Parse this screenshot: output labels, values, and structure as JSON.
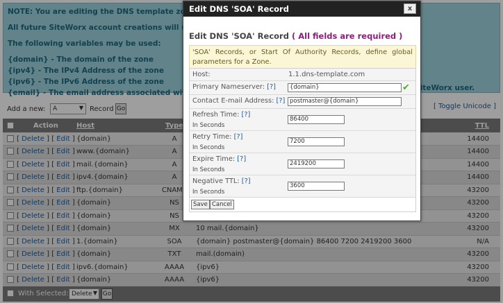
{
  "notice": {
    "lines": [
      "NOTE: You are editing the DNS template zone.",
      "All future SiteWorx account creations will use a",
      "The following variables may be used:",
      "{domain} - The domain of the zone",
      "{ipv4} - The IPv4 Address of the zone",
      "{ipv6} - The IPv6 Address of the zone",
      "{email} - The email address associated with"
    ],
    "tail": "SiteWorx user."
  },
  "addbar": {
    "label": "Add a new:",
    "select_value": "A",
    "record_label": "Record",
    "go_label": "Go",
    "toggle_label": "[ Toggle Unicode ]"
  },
  "table": {
    "headers": {
      "action": "Action",
      "host": "Host",
      "type": "Type",
      "ttl": "TTL"
    },
    "delete_label": "Delete",
    "edit_label": "Edit",
    "rows": [
      {
        "host": "{domain}",
        "type": "A",
        "data": "",
        "ttl": "14400"
      },
      {
        "host": "www.{domain}",
        "type": "A",
        "data": "",
        "ttl": "14400"
      },
      {
        "host": "mail.{domain}",
        "type": "A",
        "data": "",
        "ttl": "14400"
      },
      {
        "host": "ipv4.{domain}",
        "type": "A",
        "data": "",
        "ttl": "14400"
      },
      {
        "host": "ftp.{domain}",
        "type": "CNAME",
        "data": "",
        "ttl": "43200"
      },
      {
        "host": "{domain}",
        "type": "NS",
        "data": "",
        "ttl": "43200"
      },
      {
        "host": "{domain}",
        "type": "NS",
        "data": "",
        "ttl": "43200"
      },
      {
        "host": "{domain}",
        "type": "MX",
        "data": "10 mail.{domain}",
        "ttl": "43200"
      },
      {
        "host": "1.{domain}",
        "type": "SOA",
        "data": "{domain} postmaster@{domain} 86400 7200 2419200 3600",
        "ttl": "N/A"
      },
      {
        "host": "{domain}",
        "type": "TXT",
        "data": "mail.(domain)",
        "ttl": "43200"
      },
      {
        "host": "ipv6.{domain}",
        "type": "AAAA",
        "data": "{ipv6}",
        "ttl": "43200"
      },
      {
        "host": "{domain}",
        "type": "AAAA",
        "data": "{ipv6}",
        "ttl": "43200"
      }
    ]
  },
  "footer": {
    "with_selected": "With Selected:",
    "select_value": "Delete",
    "go_label": "Go"
  },
  "modal": {
    "title": "Edit DNS 'SOA' Record",
    "close_label": "x",
    "heading": "Edit DNS 'SOA' Record",
    "required": "( All fields are required )",
    "description": "'SOA' Records, or Start Of Authority Records, define global parameters for a Zone.",
    "host_label": "Host:",
    "host_value": "1.1.dns-template.com",
    "primary_ns_label": "Primary Nameserver:",
    "primary_ns_value": "{domain}",
    "contact_label": "Contact E-mail Address:",
    "contact_value": "postmaster@{domain}",
    "refresh_label": "Refresh Time:",
    "refresh_value": "86400",
    "retry_label": "Retry Time:",
    "retry_value": "7200",
    "expire_label": "Expire Time:",
    "expire_value": "2419200",
    "negative_label": "Negative TTL:",
    "negative_value": "3600",
    "in_seconds": "In Seconds",
    "help": "[?]",
    "save_label": "Save",
    "cancel_label": "Cancel"
  }
}
